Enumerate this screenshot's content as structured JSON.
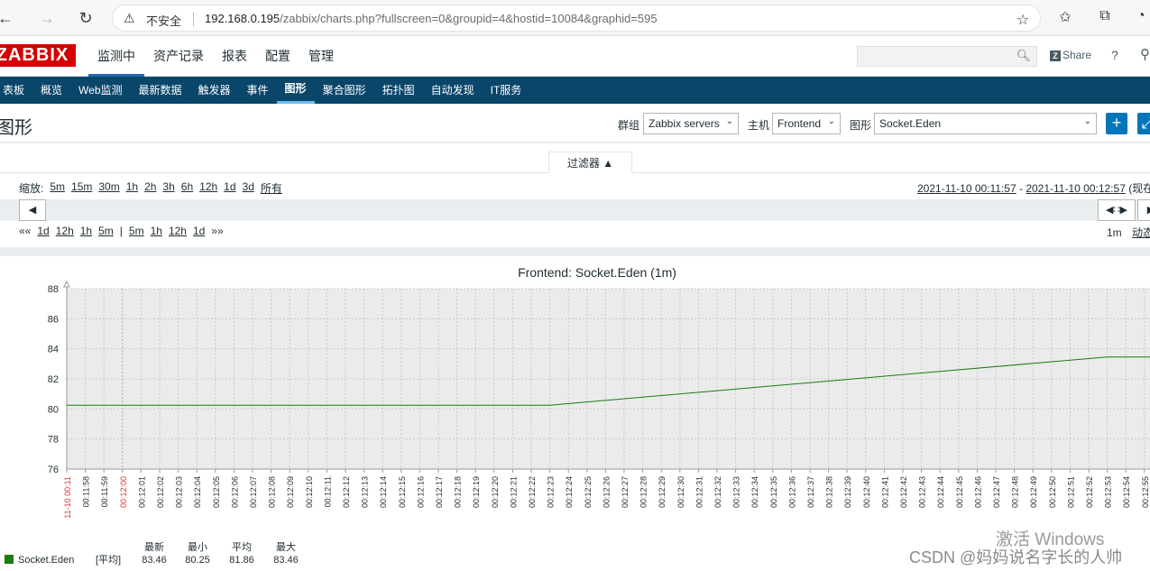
{
  "browser": {
    "insecure_label": "不安全",
    "url_host": "192.168.0.195",
    "url_rest": "/zabbix/charts.php?fullscreen=0&groupid=4&hostid=10084&graphid=595"
  },
  "header": {
    "logo": "ZABBIX",
    "menu": [
      "监测中",
      "资产记录",
      "报表",
      "配置",
      "管理"
    ],
    "share_label": "Share",
    "help_label": "?"
  },
  "subnav": [
    "表板",
    "概览",
    "Web监测",
    "最新数据",
    "触发器",
    "事件",
    "图形",
    "聚合图形",
    "拓扑图",
    "自动发现",
    "IT服务"
  ],
  "title_bar": {
    "title": "图形",
    "group_label": "群组",
    "group_value": "Zabbix servers",
    "host_label": "主机",
    "host_value": "Frontend",
    "graph_label": "图形",
    "graph_value": "Socket.Eden"
  },
  "filter": {
    "tab_label": "过滤器 ▲",
    "zoom_label": "缩放:",
    "zoom_options": [
      "5m",
      "15m",
      "30m",
      "1h",
      "2h",
      "3h",
      "6h",
      "12h",
      "1d",
      "3d",
      "所有"
    ],
    "date_from": "2021-11-10 00:11:57",
    "date_sep": " - ",
    "date_to": "2021-11-10 00:12:57",
    "date_suffix": "(现在",
    "shift_back": [
      "««",
      "1d",
      "12h",
      "1h",
      "5m"
    ],
    "shift_divider": "|",
    "shift_fwd": [
      "5m",
      "1h",
      "12h",
      "1d",
      "»»"
    ],
    "period_value": "1m",
    "dynamic_label": "动态"
  },
  "chart_data": {
    "type": "line",
    "title": "Frontend: Socket.Eden (1m)",
    "ylim": [
      76,
      88
    ],
    "yticks": [
      76,
      78,
      80,
      82,
      84,
      86,
      88
    ],
    "x_labels": [
      "11-10 00:11",
      "00:11:58",
      "00:11:59",
      "00:12:00",
      "00:12:01",
      "00:12:02",
      "00:12:03",
      "00:12:04",
      "00:12:05",
      "00:12:06",
      "00:12:07",
      "00:12:08",
      "00:12:09",
      "00:12:10",
      "00:12:11",
      "00:12:12",
      "00:12:13",
      "00:12:14",
      "00:12:15",
      "00:12:16",
      "00:12:17",
      "00:12:18",
      "00:12:19",
      "00:12:20",
      "00:12:21",
      "00:12:22",
      "00:12:23",
      "00:12:24",
      "00:12:25",
      "00:12:26",
      "00:12:27",
      "00:12:28",
      "00:12:29",
      "00:12:30",
      "00:12:31",
      "00:12:32",
      "00:12:33",
      "00:12:34",
      "00:12:35",
      "00:12:36",
      "00:12:37",
      "00:12:38",
      "00:12:39",
      "00:12:40",
      "00:12:41",
      "00:12:42",
      "00:12:43",
      "00:12:44",
      "00:12:45",
      "00:12:46",
      "00:12:47",
      "00:12:48",
      "00:12:49",
      "00:12:50",
      "00:12:51",
      "00:12:52",
      "00:12:53",
      "00:12:54",
      "00:12:55"
    ],
    "red_labels": [
      "11-10 00:11",
      "00:12:00"
    ],
    "series": [
      {
        "name": "Socket.Eden",
        "color": "#1a7c11",
        "points": [
          [
            0,
            80.25
          ],
          [
            26,
            80.25
          ],
          [
            56,
            83.46
          ],
          [
            58.5,
            83.46
          ]
        ]
      }
    ],
    "legend": {
      "headers": [
        "最新",
        "最小",
        "平均",
        "最大"
      ],
      "row": {
        "name": "Socket.Eden",
        "func": "[平均]",
        "last": "83.46",
        "min": "80.25",
        "avg": "81.86",
        "max": "83.46"
      }
    },
    "grid": true
  },
  "watermark": {
    "activate": "激活 Windows",
    "csdn": "CSDN @妈妈说名字长的人帅"
  }
}
